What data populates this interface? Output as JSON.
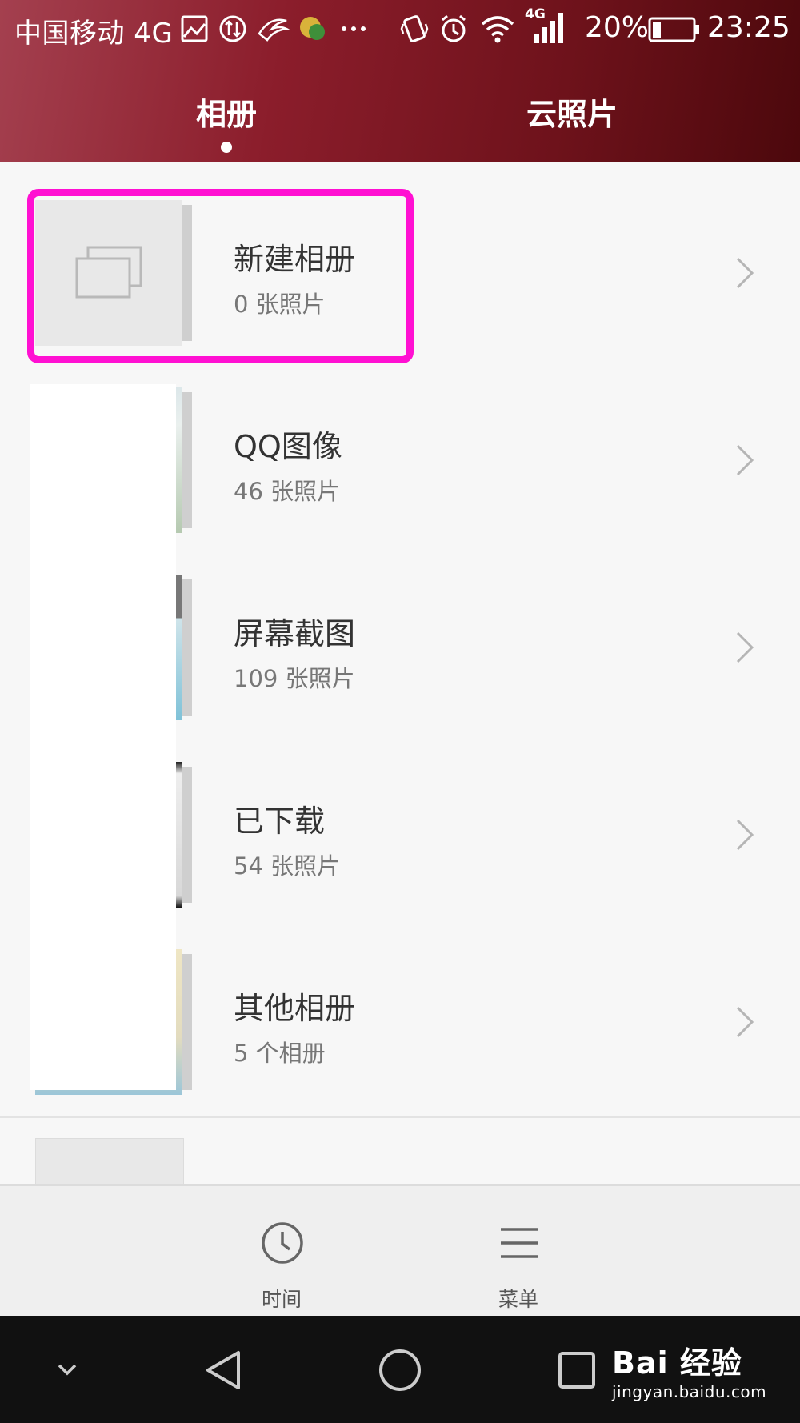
{
  "status_bar": {
    "carrier": "中国移动 4G",
    "network_badge": "4G",
    "battery_percent": "20%",
    "battery_level": 0.2,
    "time": "23:25",
    "icons": [
      "image-icon",
      "data-sync-icon",
      "sparrow-app-icon",
      "weather-app-icon",
      "more-dots-icon",
      "vibrate-icon",
      "alarm-icon",
      "wifi-icon",
      "signal-icon",
      "battery-icon"
    ]
  },
  "tabs": [
    {
      "label": "相册",
      "active": true
    },
    {
      "label": "云照片",
      "active": false
    }
  ],
  "albums": [
    {
      "name": "新建相册",
      "count": "0 张照片"
    },
    {
      "name": "QQ图像",
      "count": "46 张照片"
    },
    {
      "name": "屏幕截图",
      "count": "109 张照片"
    },
    {
      "name": "已下载",
      "count": "54 张照片"
    },
    {
      "name": "其他相册",
      "count": "5 个相册"
    }
  ],
  "bottom_bar": {
    "time_label": "时间",
    "menu_label": "菜单"
  },
  "watermark": {
    "main": "Bai 经验",
    "sub": "jingyan.baidu.com"
  },
  "colors": {
    "header_gradient_start": "#a4404f",
    "header_gradient_end": "#4c080c",
    "highlight": "#ff10d2",
    "navbar": "#111111"
  }
}
